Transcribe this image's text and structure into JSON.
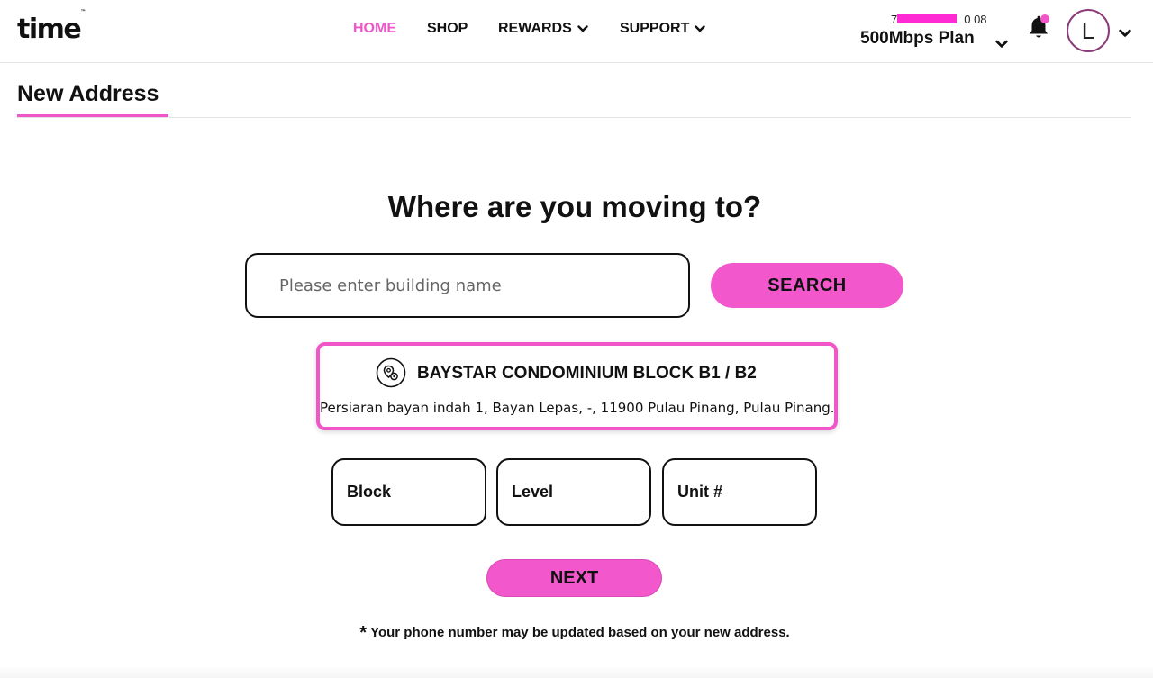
{
  "header": {
    "logo": "time",
    "logo_tm": "™",
    "nav": [
      {
        "label": "HOME",
        "active": true
      },
      {
        "label": "SHOP",
        "active": false
      },
      {
        "label": "REWARDS",
        "active": false,
        "has_dropdown": true
      },
      {
        "label": "SUPPORT",
        "active": false,
        "has_dropdown": true
      }
    ],
    "account": {
      "number_prefix": "7",
      "number_suffix": "0 08",
      "plan": "500Mbps Plan"
    },
    "avatar_initial": "L",
    "icons": [
      "bell-icon",
      "chevron-down-icon"
    ]
  },
  "page": {
    "title": "New Address"
  },
  "main": {
    "question": "Where are you moving to?",
    "search": {
      "placeholder": "Please enter building name",
      "value": "",
      "button": "SEARCH"
    },
    "result": {
      "name": "BAYSTAR CONDOMINIUM BLOCK B1 / B2",
      "address": "Persiaran bayan indah 1, Bayan Lepas, -, 11900 Pulau Pinang, Pulau Pinang.",
      "icon": "location-pin-icon"
    },
    "fields": {
      "block": "Block",
      "level": "Level",
      "unit": "Unit #"
    },
    "next_button": "NEXT",
    "note_star": "*",
    "note": "Your phone number may be updated based on your new address."
  },
  "colors": {
    "accent": "#f056c8",
    "button": "#f258cc",
    "text": "#111111"
  }
}
